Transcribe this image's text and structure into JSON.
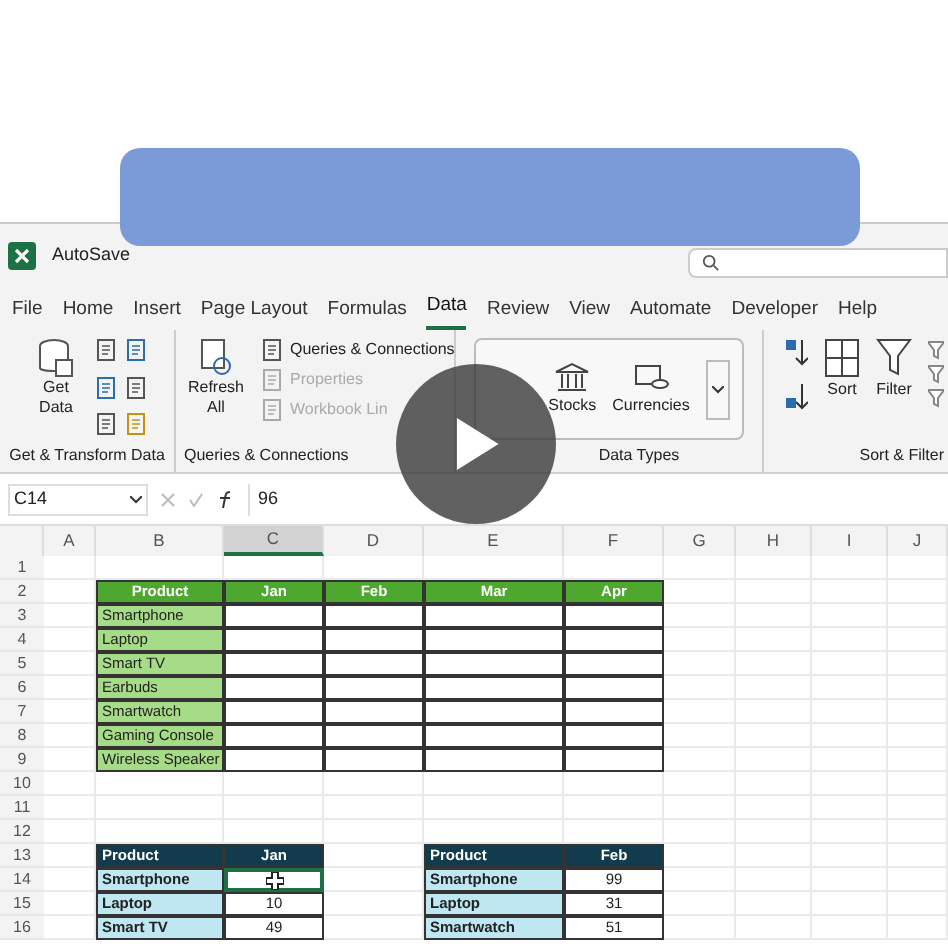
{
  "title_bar": {
    "autosave": "AutoSave"
  },
  "menu_tabs": [
    {
      "label": "File",
      "selected": false
    },
    {
      "label": "Home",
      "selected": false
    },
    {
      "label": "Insert",
      "selected": false
    },
    {
      "label": "Page Layout",
      "selected": false
    },
    {
      "label": "Formulas",
      "selected": false
    },
    {
      "label": "Data",
      "selected": true
    },
    {
      "label": "Review",
      "selected": false
    },
    {
      "label": "View",
      "selected": false
    },
    {
      "label": "Automate",
      "selected": false
    },
    {
      "label": "Developer",
      "selected": false
    },
    {
      "label": "Help",
      "selected": false
    }
  ],
  "ribbon": {
    "get_data": "Get Data",
    "get_group": "Get & Transform Data",
    "refresh": "Refresh All",
    "queries": [
      {
        "label": "Queries & Connections",
        "disabled": false
      },
      {
        "label": "Properties",
        "disabled": true
      },
      {
        "label": "Workbook Lin",
        "disabled": true
      }
    ],
    "queries_group": "Queries & Connections",
    "stocks": "Stocks",
    "currencies": "Currencies",
    "types_group": "Data Types",
    "sort": "Sort",
    "filter": "Filter",
    "sort_group": "Sort & Filter"
  },
  "name_box": "C14",
  "formula": "96",
  "columns": [
    "A",
    "B",
    "C",
    "D",
    "E",
    "F",
    "G",
    "H",
    "I",
    "J"
  ],
  "rows": [
    "1",
    "2",
    "3",
    "4",
    "5",
    "6",
    "7",
    "8",
    "9",
    "10",
    "11",
    "12",
    "13",
    "14",
    "15",
    "16"
  ],
  "table1": {
    "headers": [
      "Product",
      "Jan",
      "Feb",
      "Mar",
      "Apr"
    ],
    "products": [
      "Smartphone",
      "Laptop",
      "Smart TV",
      "Earbuds",
      "Smartwatch",
      "Gaming Console",
      "Wireless Speaker"
    ]
  },
  "table2": {
    "headers": [
      "Product",
      "Jan"
    ],
    "rows": [
      {
        "product": "Smartphone",
        "selected": true
      },
      {
        "product": "Laptop",
        "value": "10",
        "selected": false
      },
      {
        "product": "Smart TV",
        "value": "49",
        "selected": false
      }
    ]
  },
  "table3": {
    "headers": [
      "Product",
      "Feb"
    ],
    "rows": [
      {
        "product": "Smartphone",
        "value": "99"
      },
      {
        "product": "Laptop",
        "value": "31"
      },
      {
        "product": "Smartwatch",
        "value": "51"
      }
    ]
  }
}
